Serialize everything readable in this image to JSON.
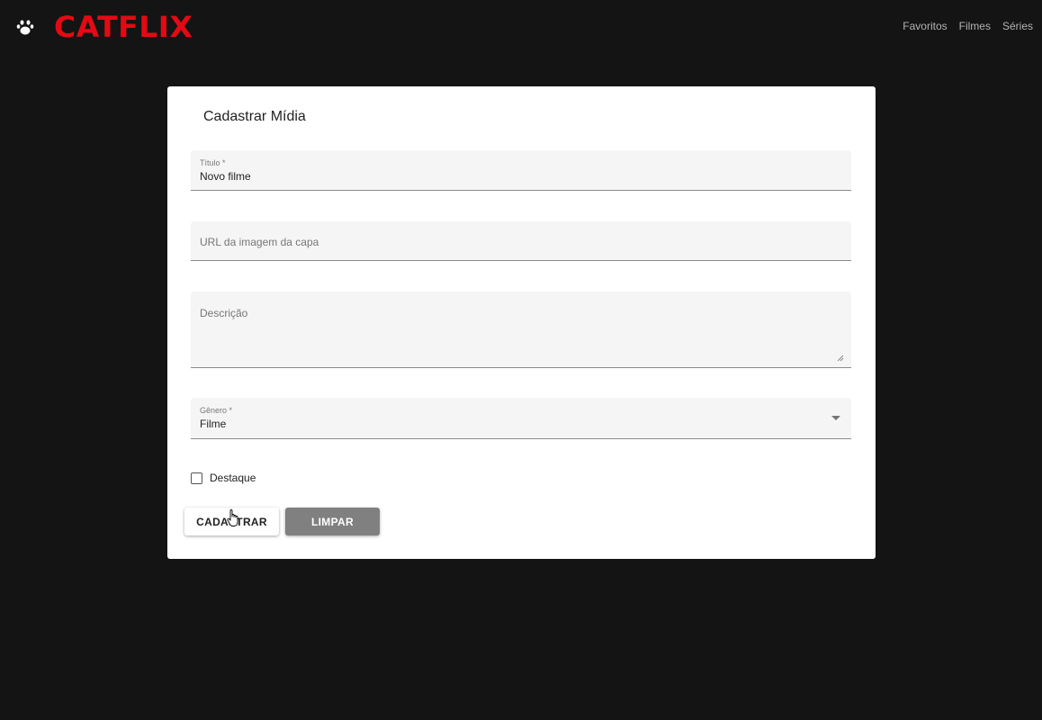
{
  "header": {
    "brand": "CATFLIX",
    "brand_color": "#e50914",
    "logo_icon": "paw-icon",
    "nav": [
      {
        "label": "Favoritos"
      },
      {
        "label": "Filmes"
      },
      {
        "label": "Séries"
      }
    ]
  },
  "form": {
    "title": "Cadastrar Mídia",
    "titulo": {
      "label": "Título *",
      "value": "Novo filme"
    },
    "url": {
      "placeholder": "URL da imagem da capa"
    },
    "descricao": {
      "placeholder": "Descrição"
    },
    "genero": {
      "label": "Gênero *",
      "value": "Filme"
    },
    "destaque": {
      "label": "Destaque",
      "checked": false
    },
    "buttons": {
      "submit": "CADASTRAR",
      "clear": "LIMPAR"
    }
  }
}
